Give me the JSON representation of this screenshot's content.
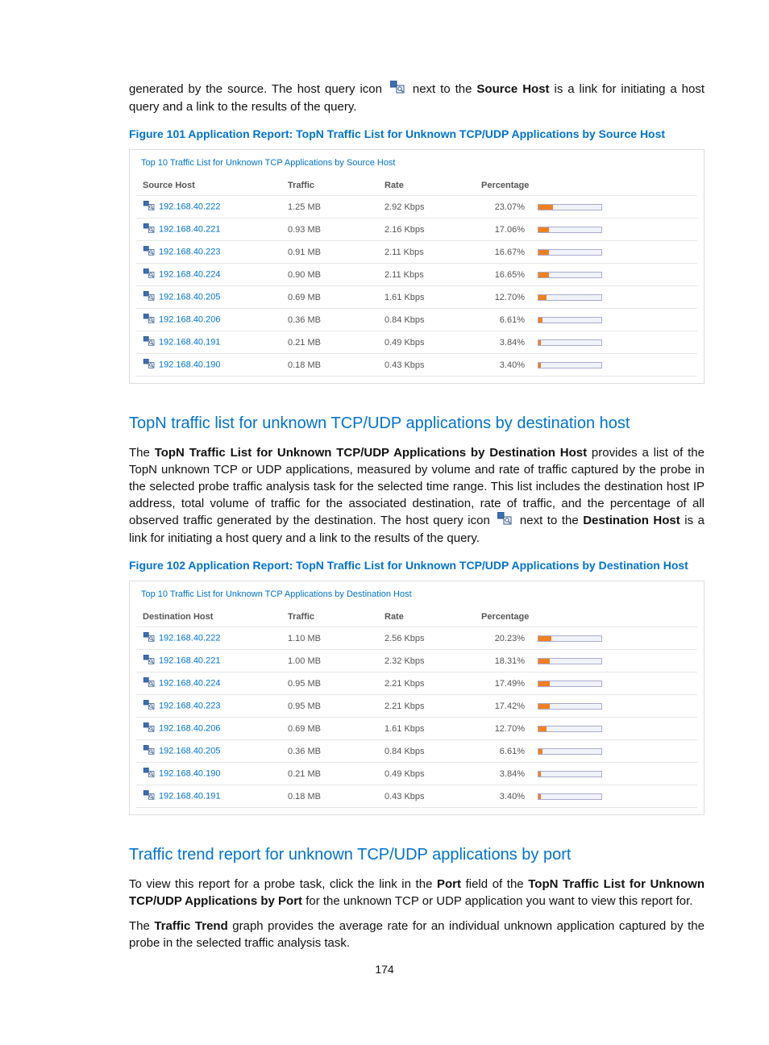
{
  "intro": {
    "p1a": "generated by the source. The host query icon ",
    "p1b": " next to the ",
    "p1_bold": "Source Host",
    "p1c": " is a link for initiating a host query and a link to the results of the query."
  },
  "fig101_caption": "Figure 101 Application Report: TopN Traffic List for Unknown TCP/UDP Applications by Source Host",
  "table1": {
    "title": "Top 10 Traffic List for Unknown TCP Applications by Source Host",
    "headers": {
      "host": "Source Host",
      "traffic": "Traffic",
      "rate": "Rate",
      "percentage": "Percentage"
    },
    "rows": [
      {
        "host": "192.168.40.222",
        "traffic": "1.25 MB",
        "rate": "2.92 Kbps",
        "pct": "23.07%",
        "pct_val": 23.07
      },
      {
        "host": "192.168.40.221",
        "traffic": "0.93 MB",
        "rate": "2.16 Kbps",
        "pct": "17.06%",
        "pct_val": 17.06
      },
      {
        "host": "192.168.40.223",
        "traffic": "0.91 MB",
        "rate": "2.11 Kbps",
        "pct": "16.67%",
        "pct_val": 16.67
      },
      {
        "host": "192.168.40.224",
        "traffic": "0.90 MB",
        "rate": "2.11 Kbps",
        "pct": "16.65%",
        "pct_val": 16.65
      },
      {
        "host": "192.168.40.205",
        "traffic": "0.69 MB",
        "rate": "1.61 Kbps",
        "pct": "12.70%",
        "pct_val": 12.7
      },
      {
        "host": "192.168.40.206",
        "traffic": "0.36 MB",
        "rate": "0.84 Kbps",
        "pct": "6.61%",
        "pct_val": 6.61
      },
      {
        "host": "192.168.40.191",
        "traffic": "0.21 MB",
        "rate": "0.49 Kbps",
        "pct": "3.84%",
        "pct_val": 3.84
      },
      {
        "host": "192.168.40.190",
        "traffic": "0.18 MB",
        "rate": "0.43 Kbps",
        "pct": "3.40%",
        "pct_val": 3.4
      }
    ]
  },
  "section2_heading": "TopN traffic list for unknown TCP/UDP applications by destination host",
  "section2_para": {
    "a": "The ",
    "bold1": "TopN Traffic List for Unknown TCP/UDP Applications by Destination Host",
    "b": " provides a list of the TopN unknown TCP or UDP applications, measured by volume and rate of traffic captured by the probe in the selected probe traffic analysis task for the selected time range. This list includes the destination host IP address, total volume of traffic for the associated destination, rate of traffic, and the percentage of all observed traffic generated by the destination. The host query icon ",
    "c": " next to the ",
    "bold2": "Destination Host",
    "d": " is a link for initiating a host query and a link to the results of the query."
  },
  "fig102_caption": "Figure 102 Application Report: TopN Traffic List for Unknown TCP/UDP Applications by Destination Host",
  "table2": {
    "title": "Top 10 Traffic List for Unknown TCP Applications by Destination Host",
    "headers": {
      "host": "Destination Host",
      "traffic": "Traffic",
      "rate": "Rate",
      "percentage": "Percentage"
    },
    "rows": [
      {
        "host": "192.168.40.222",
        "traffic": "1.10 MB",
        "rate": "2.56 Kbps",
        "pct": "20.23%",
        "pct_val": 20.23
      },
      {
        "host": "192.168.40.221",
        "traffic": "1.00 MB",
        "rate": "2.32 Kbps",
        "pct": "18.31%",
        "pct_val": 18.31
      },
      {
        "host": "192.168.40.224",
        "traffic": "0.95 MB",
        "rate": "2.21 Kbps",
        "pct": "17.49%",
        "pct_val": 17.49
      },
      {
        "host": "192.168.40.223",
        "traffic": "0.95 MB",
        "rate": "2.21 Kbps",
        "pct": "17.42%",
        "pct_val": 17.42
      },
      {
        "host": "192.168.40.206",
        "traffic": "0.69 MB",
        "rate": "1.61 Kbps",
        "pct": "12.70%",
        "pct_val": 12.7
      },
      {
        "host": "192.168.40.205",
        "traffic": "0.36 MB",
        "rate": "0.84 Kbps",
        "pct": "6.61%",
        "pct_val": 6.61
      },
      {
        "host": "192.168.40.190",
        "traffic": "0.21 MB",
        "rate": "0.49 Kbps",
        "pct": "3.84%",
        "pct_val": 3.84
      },
      {
        "host": "192.168.40.191",
        "traffic": "0.18 MB",
        "rate": "0.43 Kbps",
        "pct": "3.40%",
        "pct_val": 3.4
      }
    ]
  },
  "section3_heading": "Traffic trend report for unknown TCP/UDP applications by port",
  "section3_para1": {
    "a": "To view this report for a probe task, click the link in the ",
    "bold1": "Port",
    "b": " field of the ",
    "bold2": "TopN Traffic List for Unknown TCP/UDP Applications by Port",
    "c": " for the unknown TCP or UDP application you want to view this report for."
  },
  "section3_para2": {
    "a": "The ",
    "bold1": "Traffic Trend",
    "b": " graph provides the average rate for an individual unknown application captured by the probe in the selected traffic analysis task."
  },
  "page_number": "174"
}
